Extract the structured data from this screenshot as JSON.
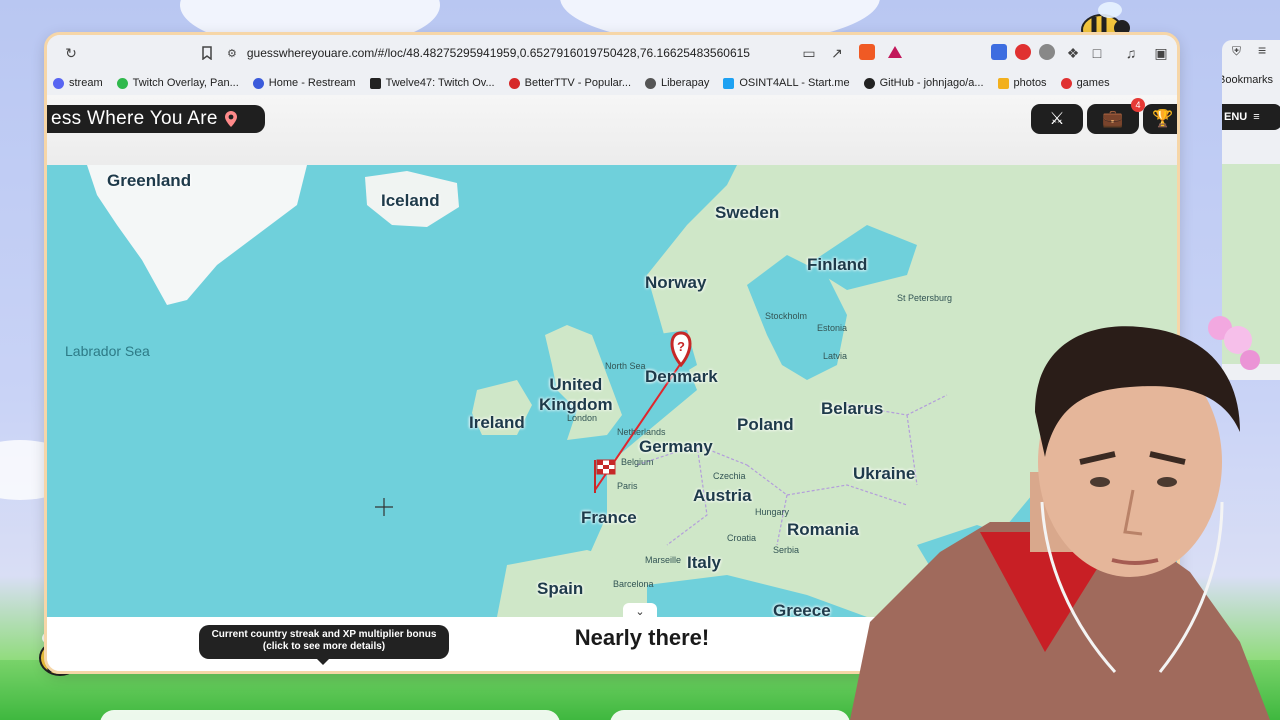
{
  "browser": {
    "url": "guesswhereyouare.com/#/loc/48.48275295941959,0.6527916019750428,76.16625483560615",
    "bookmarks": [
      {
        "label": "stream",
        "color": "#5865f2"
      },
      {
        "label": "Twitch Overlay, Pan...",
        "color": "#2fb84c"
      },
      {
        "label": "Home - Restream",
        "color": "#3b5bdb"
      },
      {
        "label": "Twelve47: Twitch Ov...",
        "color": "#222222"
      },
      {
        "label": "BetterTTV - Popular...",
        "color": "#d62828"
      },
      {
        "label": "Liberapay",
        "color": "#555555"
      },
      {
        "label": "OSINT4ALL - Start.me",
        "color": "#1da1f2"
      },
      {
        "label": "GitHub - johnjago/a...",
        "color": "#222222"
      },
      {
        "label": "photos",
        "color": "#f2b01e"
      },
      {
        "label": "games",
        "color": "#e03131"
      }
    ],
    "side_bookmarks_label": "Bookmarks"
  },
  "site": {
    "title": "ess Where You Are",
    "menu_label": "ENU",
    "notification_count": "4"
  },
  "map": {
    "labels": {
      "greenland": "Greenland",
      "iceland": "Iceland",
      "sweden": "Sweden",
      "finland": "Finland",
      "norway": "Norway",
      "labrador_sea": "Labrador Sea",
      "united_kingdom": "United\nKingdom",
      "ireland": "Ireland",
      "denmark": "Denmark",
      "belarus": "Belarus",
      "poland": "Poland",
      "germany": "Germany",
      "ukraine": "Ukraine",
      "austria": "Austria",
      "france": "France",
      "romania": "Romania",
      "italy": "Italy",
      "spain": "Spain",
      "greece": "Greece"
    },
    "small_labels": {
      "stockholm": "Stockholm",
      "estonia": "Estonia",
      "latvia": "Latvia",
      "netherlands": "Netherlands",
      "london": "London",
      "paris": "Paris",
      "czechia": "Czechia",
      "hungary": "Hungary",
      "serbia": "Serbia",
      "barcelona": "Barcelona",
      "marseille": "Marseille",
      "croatia": "Croatia",
      "belgium": "Belgium",
      "north_sea": "North Sea",
      "st_petersburg": "St Petersburg"
    }
  },
  "footer": {
    "streak_tooltip": "Current country streak and XP multiplier bonus (click to see more details)",
    "status": "Nearly there!"
  },
  "colors": {
    "water": "#6fd0db",
    "land": "#cfe7c8",
    "ice": "#f4f7f7",
    "guess_line": "#e0262d"
  }
}
